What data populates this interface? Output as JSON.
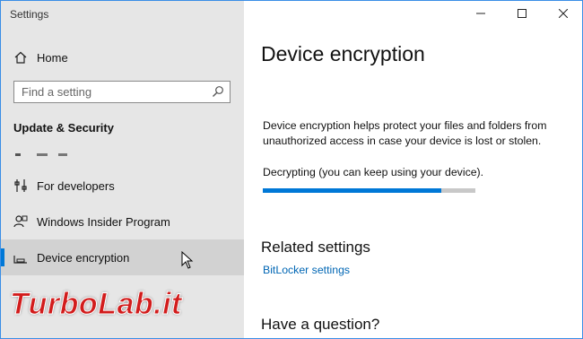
{
  "window": {
    "title": "Settings",
    "controls": {
      "minimize": "minimize-icon",
      "maximize": "maximize-icon",
      "close": "close-icon"
    }
  },
  "sidebar": {
    "home_label": "Home",
    "search": {
      "placeholder": "Find a setting",
      "value": ""
    },
    "section_title": "Update & Security",
    "items": [
      {
        "label": "For developers",
        "icon": "developer-tools-icon"
      },
      {
        "label": "Windows Insider Program",
        "icon": "insider-icon"
      },
      {
        "label": "Device encryption",
        "icon": "device-encryption-icon",
        "selected": true
      }
    ]
  },
  "main": {
    "title": "Device encryption",
    "description": "Device encryption helps protect your files and folders from unauthorized access in case your device is lost or stolen.",
    "status_text": "Decrypting (you can keep using your device).",
    "progress_fraction": 0.84,
    "related_heading": "Related settings",
    "related_link": "BitLocker settings",
    "question_heading": "Have a question?"
  },
  "watermark": {
    "text": "TurboLab.it"
  },
  "colors": {
    "accent": "#0078d7",
    "link": "#0066b4",
    "sidebar_bg": "#e6e6e6",
    "selected_bg": "#d2d2d2",
    "progress_track": "#c8c8c8",
    "watermark": "#d21c1c"
  }
}
